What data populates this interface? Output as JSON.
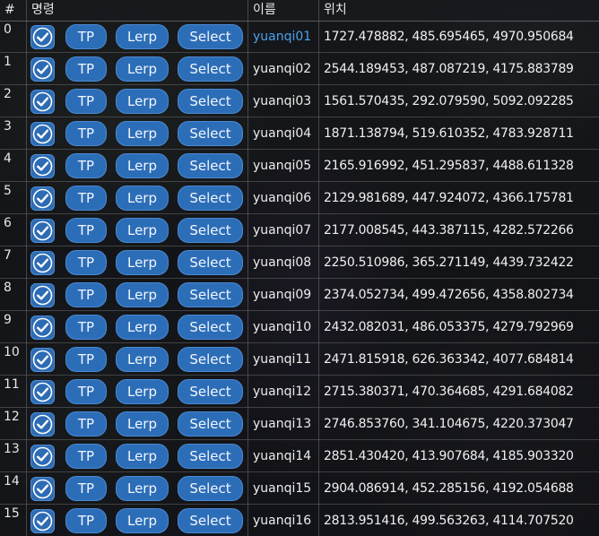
{
  "header": {
    "index_label": "#",
    "command_label": "명령",
    "name_label": "이름",
    "position_label": "위치"
  },
  "buttons": {
    "tp_label": "TP",
    "lerp_label": "Lerp",
    "select_label": "Select"
  },
  "colors": {
    "accent": "#2c6db8",
    "selected_name": "#4aa2ec"
  },
  "icons": {
    "checkbox": "checkmark-icon"
  },
  "rows": [
    {
      "index": "0",
      "checked": true,
      "name": "yuanqi01",
      "selected": true,
      "position": "1727.478882, 485.695465, 4970.950684"
    },
    {
      "index": "1",
      "checked": true,
      "name": "yuanqi02",
      "selected": false,
      "position": "2544.189453, 487.087219, 4175.883789"
    },
    {
      "index": "2",
      "checked": true,
      "name": "yuanqi03",
      "selected": false,
      "position": "1561.570435, 292.079590, 5092.092285"
    },
    {
      "index": "3",
      "checked": true,
      "name": "yuanqi04",
      "selected": false,
      "position": "1871.138794, 519.610352, 4783.928711"
    },
    {
      "index": "4",
      "checked": true,
      "name": "yuanqi05",
      "selected": false,
      "position": "2165.916992, 451.295837, 4488.611328"
    },
    {
      "index": "5",
      "checked": true,
      "name": "yuanqi06",
      "selected": false,
      "position": "2129.981689, 447.924072, 4366.175781"
    },
    {
      "index": "6",
      "checked": true,
      "name": "yuanqi07",
      "selected": false,
      "position": "2177.008545, 443.387115, 4282.572266"
    },
    {
      "index": "7",
      "checked": true,
      "name": "yuanqi08",
      "selected": false,
      "position": "2250.510986, 365.271149, 4439.732422"
    },
    {
      "index": "8",
      "checked": true,
      "name": "yuanqi09",
      "selected": false,
      "position": "2374.052734, 499.472656, 4358.802734"
    },
    {
      "index": "9",
      "checked": true,
      "name": "yuanqi10",
      "selected": false,
      "position": "2432.082031, 486.053375, 4279.792969"
    },
    {
      "index": "10",
      "checked": true,
      "name": "yuanqi11",
      "selected": false,
      "position": "2471.815918, 626.363342, 4077.684814"
    },
    {
      "index": "11",
      "checked": true,
      "name": "yuanqi12",
      "selected": false,
      "position": "2715.380371, 470.364685, 4291.684082"
    },
    {
      "index": "12",
      "checked": true,
      "name": "yuanqi13",
      "selected": false,
      "position": "2746.853760, 341.104675, 4220.373047"
    },
    {
      "index": "13",
      "checked": true,
      "name": "yuanqi14",
      "selected": false,
      "position": "2851.430420, 413.907684, 4185.903320"
    },
    {
      "index": "14",
      "checked": true,
      "name": "yuanqi15",
      "selected": false,
      "position": "2904.086914, 452.285156, 4192.054688"
    },
    {
      "index": "15",
      "checked": true,
      "name": "yuanqi16",
      "selected": false,
      "position": "2813.951416, 499.563263, 4114.707520"
    }
  ]
}
